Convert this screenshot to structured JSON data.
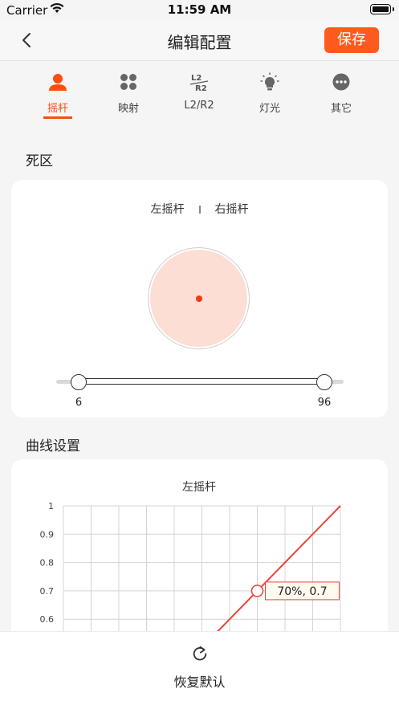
{
  "status_bar": {
    "carrier": "Carrier",
    "time": "11:59 AM"
  },
  "nav": {
    "title": "编辑配置",
    "save_label": "保存"
  },
  "tabs": [
    {
      "label": "摇杆",
      "icon": "person-icon",
      "active": true
    },
    {
      "label": "映射",
      "icon": "four-dots-icon",
      "active": false
    },
    {
      "label": "L2/R2",
      "icon": "l2-r2-icon",
      "active": false
    },
    {
      "label": "灯光",
      "icon": "lightbulb-icon",
      "active": false
    },
    {
      "label": "其它",
      "icon": "more-icon",
      "active": false
    }
  ],
  "deadzone": {
    "section_title": "死区",
    "left_stick": "左摇杆",
    "right_stick": "右摇杆",
    "slider_min_label": "6",
    "slider_max_label": "96",
    "range_min": 6,
    "range_max": 96,
    "scale_max": 100
  },
  "curve": {
    "section_title": "曲线设置",
    "chart_title": "左摇杆",
    "marker_label": "70%, 0.7"
  },
  "chart_data": {
    "type": "line",
    "title": "左摇杆",
    "y_ticks": [
      "1",
      "0.9",
      "0.8",
      "0.7",
      "0.6"
    ],
    "xlim": [
      0,
      1
    ],
    "ylim": [
      0,
      1
    ],
    "grid": true,
    "series": [
      {
        "values": [
          [
            0.5,
            0.5
          ],
          [
            1.0,
            1.0
          ]
        ],
        "color": "#e8443a"
      }
    ],
    "marker": {
      "x": 0.7,
      "y": 0.7,
      "label": "70%, 0.7"
    }
  },
  "bottom": {
    "reset_label": "恢复默认"
  },
  "colors": {
    "accent": "#ff5a1e",
    "active_tab": "#ff4d12",
    "curve": "#e8443a"
  }
}
